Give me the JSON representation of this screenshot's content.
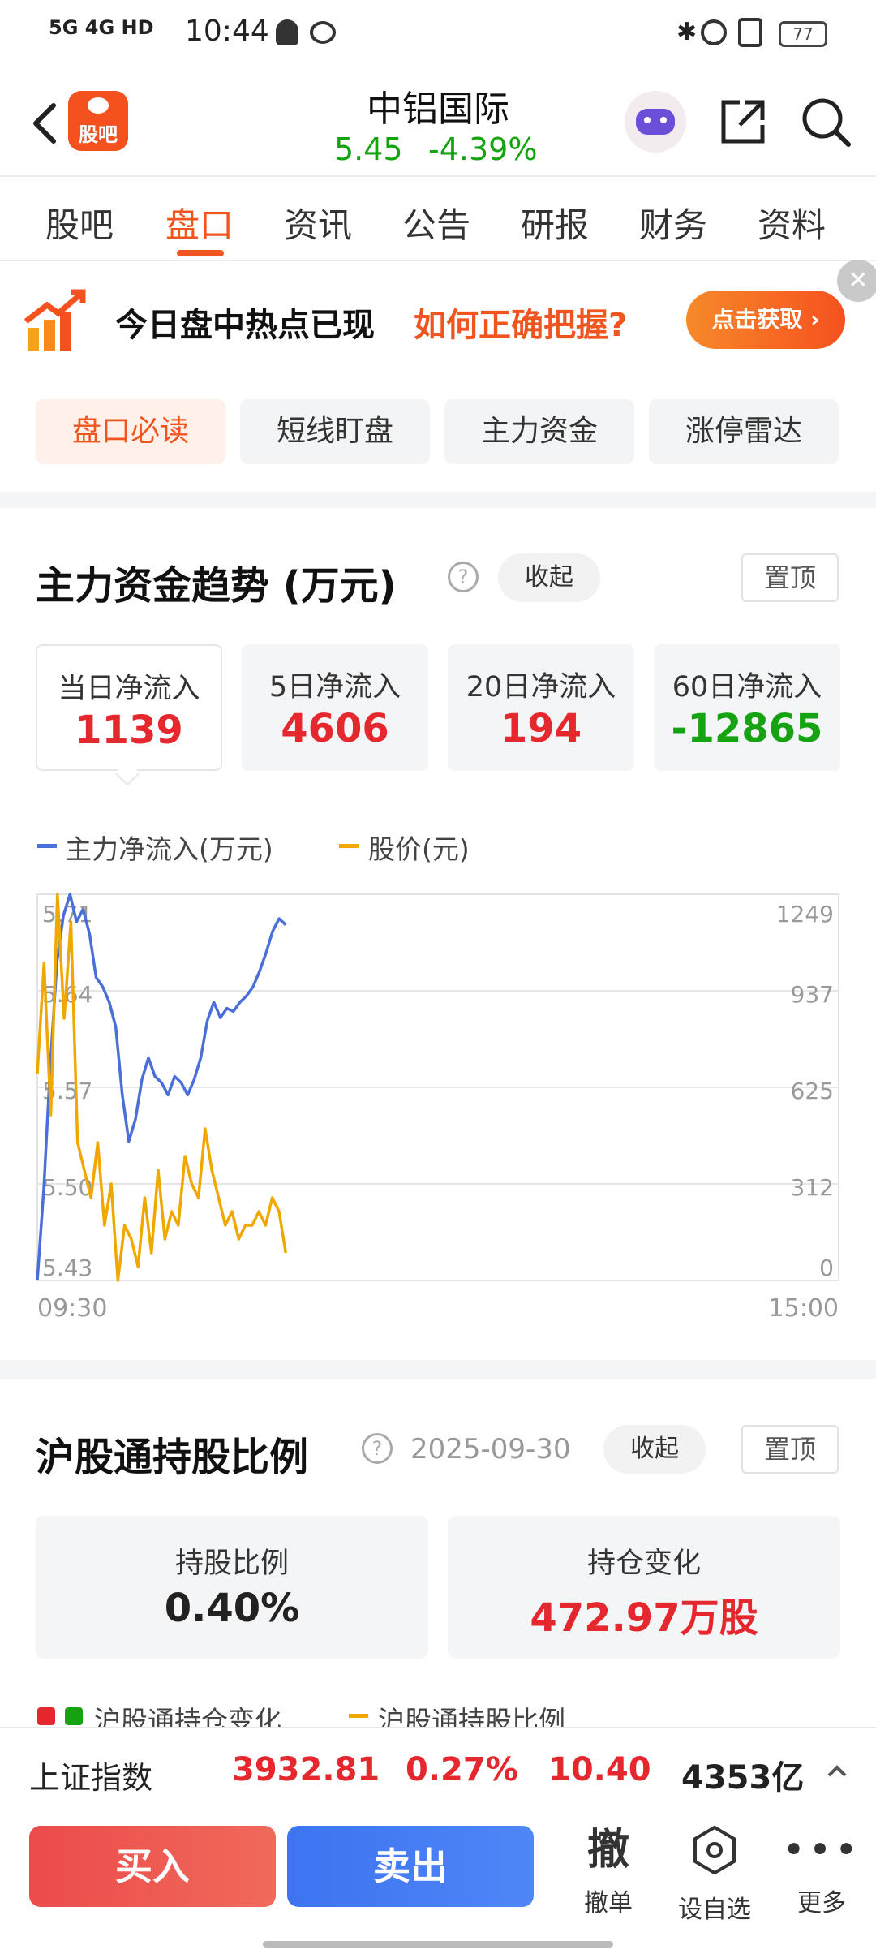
{
  "status_bar": {
    "network": "5G 4G HD",
    "time": "10:44",
    "battery": "77"
  },
  "header": {
    "logo_text": "股吧",
    "stock_name": "中铝国际",
    "price": "5.45",
    "change_pct": "-4.39%"
  },
  "tabs": [
    {
      "label": "股吧"
    },
    {
      "label": "盘口"
    },
    {
      "label": "资讯"
    },
    {
      "label": "公告"
    },
    {
      "label": "研报"
    },
    {
      "label": "财务"
    },
    {
      "label": "资料"
    }
  ],
  "banner": {
    "text_black": "今日盘中热点已现",
    "text_orange": "如何正确把握?",
    "button": "点击获取 ›"
  },
  "subtabs": [
    {
      "label": "盘口必读"
    },
    {
      "label": "短线盯盘"
    },
    {
      "label": "主力资金"
    },
    {
      "label": "涨停雷达"
    }
  ],
  "capital_trend": {
    "title": "主力资金趋势 (万元)",
    "collapse": "收起",
    "pin": "置顶",
    "boxes": [
      {
        "label": "当日净流入",
        "value": "1139"
      },
      {
        "label": "5日净流入",
        "value": "4606"
      },
      {
        "label": "20日净流入",
        "value": "194"
      },
      {
        "label": "60日净流入",
        "value": "-12865"
      }
    ]
  },
  "colors": {
    "accent": "#f0551f",
    "up": "#e5282d",
    "down": "#15a312",
    "inflow_line": "#4a6fd8",
    "price_line": "#f0a800"
  },
  "chart_data": {
    "type": "line",
    "legend": [
      "主力净流入(万元)",
      "股价(元)"
    ],
    "x_start": "09:30",
    "x_end": "15:00",
    "left_ticks": [
      "5.71",
      "5.64",
      "5.57",
      "5.50",
      "5.43"
    ],
    "right_ticks": [
      "1249",
      "937",
      "625",
      "312",
      "0"
    ],
    "left_range": [
      5.43,
      5.71
    ],
    "right_range": [
      0,
      1249
    ],
    "series": [
      {
        "name": "主力净流入(万元)",
        "axis": "right",
        "values": [
          0,
          300,
          700,
          1030,
          1180,
          1250,
          1160,
          1200,
          1120,
          980,
          950,
          900,
          820,
          600,
          450,
          520,
          650,
          720,
          660,
          640,
          600,
          660,
          640,
          600,
          650,
          720,
          840,
          900,
          850,
          880,
          870,
          900,
          920,
          950,
          1000,
          1060,
          1130,
          1170,
          1150
        ]
      },
      {
        "name": "股价(元)",
        "axis": "left",
        "values": [
          5.58,
          5.66,
          5.55,
          5.71,
          5.62,
          5.69,
          5.53,
          5.51,
          5.49,
          5.53,
          5.47,
          5.5,
          5.43,
          5.47,
          5.46,
          5.44,
          5.49,
          5.45,
          5.51,
          5.46,
          5.48,
          5.47,
          5.52,
          5.5,
          5.49,
          5.54,
          5.51,
          5.49,
          5.47,
          5.48,
          5.46,
          5.47,
          5.47,
          5.48,
          5.47,
          5.49,
          5.48,
          5.45
        ]
      }
    ]
  },
  "hsgt": {
    "title": "沪股通持股比例",
    "date": "2025-09-30",
    "collapse": "收起",
    "pin": "置顶",
    "holding_label": "持股比例",
    "holding_value": "0.40%",
    "change_label": "持仓变化",
    "change_value": "472.97万股",
    "legend_change": "沪股通持仓变化",
    "legend_ratio": "沪股通持股比例"
  },
  "ticker": {
    "name": "上证指数",
    "price": "3932.81",
    "pct": "0.27%",
    "chg": "10.40",
    "vol": "4353亿"
  },
  "bottom_bar": {
    "buy": "买入",
    "sell": "卖出",
    "cancel_icon_char": "撤",
    "cancel": "撤单",
    "watch": "设自选",
    "more": "更多"
  }
}
